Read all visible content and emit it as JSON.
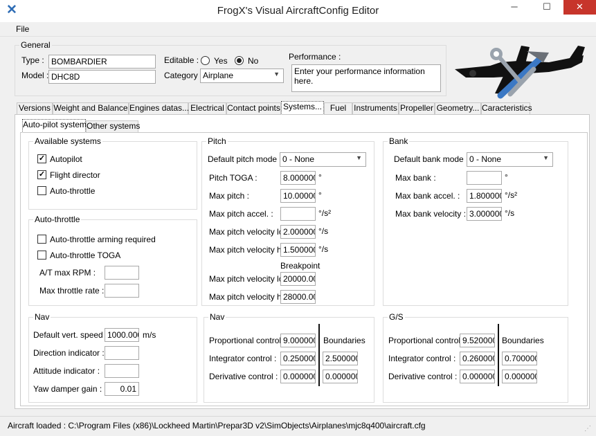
{
  "window": {
    "title": "FrogX's Visual AircraftConfig Editor",
    "minimize": "─",
    "maximize": "☐",
    "close": "✕"
  },
  "menu": {
    "file": "File"
  },
  "general": {
    "title": "General",
    "type_label": "Type :",
    "type_value": "BOMBARDIER",
    "model_label": "Model :",
    "model_value": "DHC8D",
    "editable_label": "Editable :",
    "yes": "Yes",
    "no": "No",
    "category_label": "Category :",
    "category_value": "Airplane",
    "performance_label": "Performance :",
    "performance_value": "Enter your performance information here."
  },
  "tabs": [
    "Versions",
    "Weight and Balance",
    "Engines datas...",
    "Electrical",
    "Contact points",
    "Systems...",
    "Fuel",
    "Instruments",
    "Propeller",
    "Geometry...",
    "Caracteristics"
  ],
  "subtabs": [
    "Auto-pilot system",
    "Other systems"
  ],
  "available_systems": {
    "title": "Available systems",
    "autopilot": "Autopilot",
    "flight_director": "Flight director",
    "auto_throttle": "Auto-throttle"
  },
  "autothrottle": {
    "title": "Auto-throttle",
    "arming": "Auto-throttle arming required",
    "toga": "Auto-throttle TOGA",
    "max_rpm": "A/T max RPM :",
    "max_rate": "Max throttle rate :"
  },
  "pitch": {
    "title": "Pitch",
    "default_mode_label": "Default pitch mode :",
    "default_mode_value": "0 - None",
    "toga_label": "Pitch TOGA :",
    "toga_value": "8.000000",
    "toga_unit": "°",
    "max_label": "Max pitch :",
    "max_value": "10.000000",
    "max_unit": "°",
    "accel_label": "Max pitch accel. :",
    "accel_unit": "°/s²",
    "vel_lo_label": "Max pitch velocity lo. :",
    "vel_lo_value": "2.000000",
    "vel_lo_unit": "°/s",
    "vel_hi_label": "Max pitch velocity hi. :",
    "vel_hi_value": "1.500000",
    "vel_hi_unit": "°/s",
    "breakpoint": "Breakpoint",
    "bp_lo_label": "Max pitch velocity  lo:",
    "bp_lo_value": "20000.00",
    "bp_hi_label": "Max pitch velocity  hi:",
    "bp_hi_value": "28000.00"
  },
  "bank": {
    "title": "Bank",
    "default_mode_label": "Default bank mode :",
    "default_mode_value": "0 - None",
    "max_label": "Max bank :",
    "max_unit": "°",
    "accel_label": "Max bank accel. :",
    "accel_value": "1.800000",
    "accel_unit": "°/s²",
    "vel_label": "Max bank velocity :",
    "vel_value": "3.000000",
    "vel_unit": "°/s"
  },
  "nav_left": {
    "title": "Nav",
    "vert_speed_label": "Default vert. speed :",
    "vert_speed_value": "1000.000",
    "vert_speed_unit": "m/s",
    "direction_label": "Direction indicator :",
    "attitude_label": "Attitude indicator :",
    "yaw_label": "Yaw damper gain :",
    "yaw_value": "0.01"
  },
  "nav_mid": {
    "title": "Nav",
    "prop_label": "Proportional control :",
    "prop_value": "9.000000",
    "boundaries": "Boundaries",
    "int_label": "Integrator control :",
    "int_value": "0.250000",
    "int_bound": "2.500000",
    "deriv_label": "Derivative control :",
    "deriv_value": "0.000000",
    "deriv_bound": "0.000000"
  },
  "gs": {
    "title": "G/S",
    "prop_label": "Proportional control :",
    "prop_value": "9.520000",
    "boundaries": "Boundaries",
    "int_label": "Integrator control :",
    "int_value": "0.260000",
    "int_bound": "0.700000",
    "deriv_label": "Derivative control :",
    "deriv_value": "0.000000",
    "deriv_bound": "0.000000"
  },
  "status": {
    "text": "Aircraft loaded : C:\\Program Files (x86)\\Lockheed Martin\\Prepar3D v2\\SimObjects\\Airplanes\\mjc8q400\\aircraft.cfg"
  },
  "icons": {
    "app": "x-logo-icon",
    "logo": "airplane-tools-logo"
  }
}
